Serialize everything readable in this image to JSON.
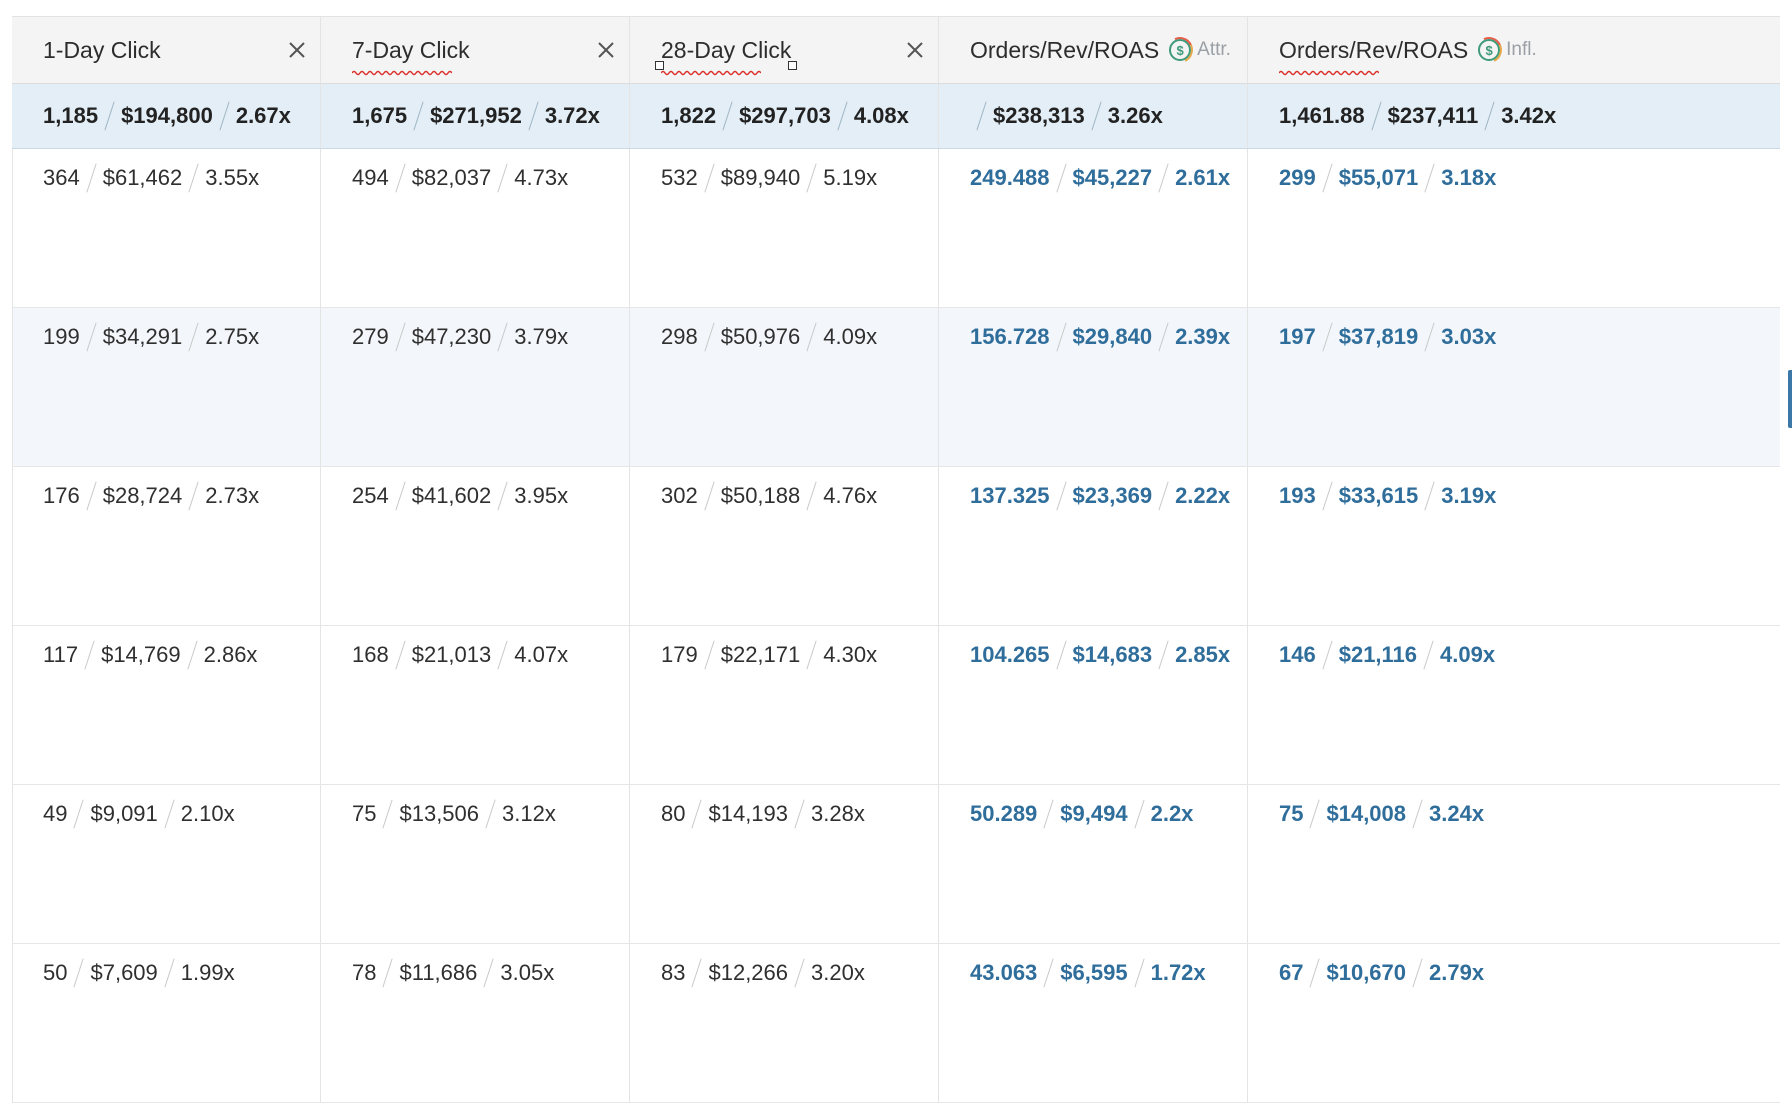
{
  "headers": [
    {
      "label": "1-Day Click",
      "closable": true,
      "squiggle": false
    },
    {
      "label": "7-Day Click",
      "closable": true,
      "squiggle": true
    },
    {
      "label": "28-Day Click",
      "closable": true,
      "squiggle": true,
      "selected": true
    },
    {
      "label": "Orders/Rev/ROAS",
      "tag": "Attr.",
      "icon": "dollar-icon",
      "squiggle": false
    },
    {
      "label": "Orders/Rev/ROAS",
      "tag": "Infl.",
      "icon": "dollar-icon",
      "squiggle": true
    }
  ],
  "totals": [
    [
      "1,185",
      "$194,800",
      "2.67x"
    ],
    [
      "1,675",
      "$271,952",
      "3.72x"
    ],
    [
      "1,822",
      "$297,703",
      "4.08x"
    ],
    [
      "",
      "$238,313",
      "3.26x"
    ],
    [
      "1,461.88",
      "$237,411",
      "3.42x"
    ]
  ],
  "rows": [
    [
      [
        "364",
        "$61,462",
        "3.55x"
      ],
      [
        "494",
        "$82,037",
        "4.73x"
      ],
      [
        "532",
        "$89,940",
        "5.19x"
      ],
      [
        "249.488",
        "$45,227",
        "2.61x"
      ],
      [
        "299",
        "$55,071",
        "3.18x"
      ]
    ],
    [
      [
        "199",
        "$34,291",
        "2.75x"
      ],
      [
        "279",
        "$47,230",
        "3.79x"
      ],
      [
        "298",
        "$50,976",
        "4.09x"
      ],
      [
        "156.728",
        "$29,840",
        "2.39x"
      ],
      [
        "197",
        "$37,819",
        "3.03x"
      ]
    ],
    [
      [
        "176",
        "$28,724",
        "2.73x"
      ],
      [
        "254",
        "$41,602",
        "3.95x"
      ],
      [
        "302",
        "$50,188",
        "4.76x"
      ],
      [
        "137.325",
        "$23,369",
        "2.22x"
      ],
      [
        "193",
        "$33,615",
        "3.19x"
      ]
    ],
    [
      [
        "117",
        "$14,769",
        "2.86x"
      ],
      [
        "168",
        "$21,013",
        "4.07x"
      ],
      [
        "179",
        "$22,171",
        "4.30x"
      ],
      [
        "104.265",
        "$14,683",
        "2.85x"
      ],
      [
        "146",
        "$21,116",
        "4.09x"
      ]
    ],
    [
      [
        "49",
        "$9,091",
        "2.10x"
      ],
      [
        "75",
        "$13,506",
        "3.12x"
      ],
      [
        "80",
        "$14,193",
        "3.28x"
      ],
      [
        "50.289",
        "$9,494",
        "2.2x"
      ],
      [
        "75",
        "$14,008",
        "3.24x"
      ]
    ],
    [
      [
        "50",
        "$7,609",
        "1.99x"
      ],
      [
        "78",
        "$11,686",
        "3.05x"
      ],
      [
        "83",
        "$12,266",
        "3.20x"
      ],
      [
        "43.063",
        "$6,595",
        "1.72x"
      ],
      [
        "67",
        "$10,670",
        "2.79x"
      ]
    ]
  ],
  "colors": {
    "header_bg": "#f4f4f4",
    "total_bg": "#e3eef6",
    "alt_row_bg": "#f3f6fa",
    "blue_text": "#2f6d9b",
    "squiggle": "#d9322b"
  }
}
